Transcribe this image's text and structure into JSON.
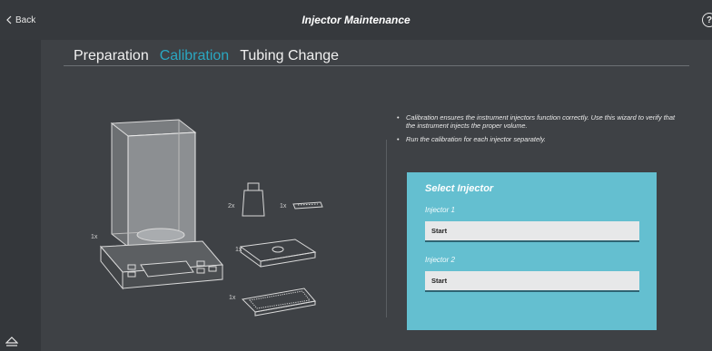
{
  "header": {
    "back_label": "Back",
    "title": "Injector Maintenance",
    "help_label": "?"
  },
  "tabs": [
    {
      "label": "Preparation",
      "active": false
    },
    {
      "label": "Calibration",
      "active": true
    },
    {
      "label": "Tubing Change",
      "active": false
    }
  ],
  "colors": {
    "accent": "#2aa7c1",
    "panel": "#64bfd0",
    "background": "#3e4145"
  },
  "illustration": {
    "balance_qty": "1x",
    "bottle_qty": "2x",
    "strip_qty": "1x",
    "plate_qty": "1x",
    "microplate_qty": "1x"
  },
  "instructions": [
    "Calibration ensures the instrument injectors function correctly. Use this wizard to verify that the instrument injects the proper volume.",
    "Run the calibration for each injector separately."
  ],
  "select_panel": {
    "title": "Select Injector",
    "injectors": [
      {
        "label": "Injector 1",
        "button": "Start"
      },
      {
        "label": "Injector 2",
        "button": "Start"
      }
    ]
  },
  "icons": {
    "back": "chevron-left-icon",
    "help": "question-icon",
    "eject": "eject-icon"
  }
}
